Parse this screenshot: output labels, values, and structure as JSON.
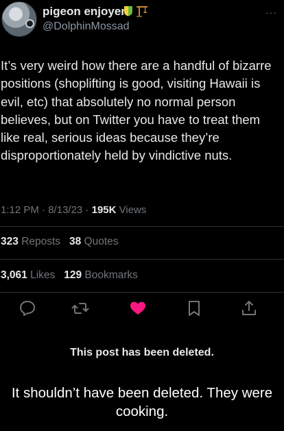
{
  "author": {
    "display_name": "pigeon enjoyer",
    "handle": "@DolphinMossad",
    "badge_icons": [
      "shield-icon",
      "construction-crane-icon"
    ]
  },
  "menu": {
    "label": "···"
  },
  "tweet": {
    "text": "It’s very weird how there are a handful of bizarre positions (shoplifting is good, visiting Hawaii is evil, etc) that absolutely no normal person believes, but on Twitter you have to treat them like real, serious ideas because they’re disproportionately held by vindictive nuts.",
    "time": "1:12 PM",
    "date": "8/13/23",
    "views_count": "195K",
    "views_label": "Views",
    "separator": "·"
  },
  "stats": {
    "reposts_count": "323",
    "reposts_label": "Reposts",
    "quotes_count": "38",
    "quotes_label": "Quotes",
    "likes_count": "3,061",
    "likes_label": "Likes",
    "bookmarks_count": "129",
    "bookmarks_label": "Bookmarks"
  },
  "actions": [
    "reply-icon",
    "repost-icon",
    "like-icon",
    "bookmark-icon",
    "share-icon"
  ],
  "colors": {
    "like": "#f91880",
    "muted": "#71767b",
    "text": "#e7e9ea",
    "divider": "#2f3336"
  },
  "notice": "This post has been deleted.",
  "caption": "It shouldn’t have been deleted. They were cooking."
}
